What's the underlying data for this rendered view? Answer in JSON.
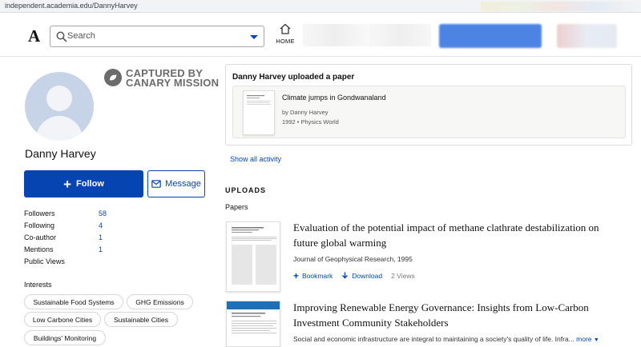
{
  "browser": {
    "url": "independent.academia.edu/DannyHarvey"
  },
  "header": {
    "logo": "A",
    "search_placeholder": "Search",
    "home_label": "HOME"
  },
  "profile": {
    "name": "Danny Harvey",
    "watermark": {
      "line1": "CAPTURED BY",
      "line2": "CANARY MISSION"
    },
    "follow_label": "Follow",
    "message_label": "Message",
    "stats": [
      {
        "label": "Followers",
        "value": "58"
      },
      {
        "label": "Following",
        "value": "4"
      },
      {
        "label": "Co-author",
        "value": "1"
      },
      {
        "label": "Mentions",
        "value": "1"
      },
      {
        "label": "Public Views",
        "value": ""
      }
    ],
    "interests_title": "Interests",
    "interests": [
      "Sustainable Food Systems",
      "GHG Emissions",
      "Low Carbone Cities",
      "Sustainable Cities",
      "Buildings' Monitoring"
    ]
  },
  "activity": {
    "title": "Danny Harvey uploaded a paper",
    "paper_title": "Climate jumps in Gondwanaland",
    "author": "by Danny Harvey",
    "meta": "1992 • Physics World",
    "show_all": "Show all activity"
  },
  "uploads": {
    "heading": "UPLOADS",
    "subheading": "Papers",
    "items": [
      {
        "title_line1": "Evaluation of the potential impact of methane clathrate destabilization on",
        "title_line2": "future global warming",
        "journal": "Journal of Geophysical Research, 1995",
        "bookmark": "Bookmark",
        "download": "Download",
        "views": "2 Views"
      },
      {
        "title_line1": "Improving Renewable Energy Governance: Insights from Low-Carbon",
        "title_line2": "Investment Community Stakeholders",
        "abstract": "Social and economic infrastructure are integral to maintaining a society's quality of life. Infra...",
        "more": "more"
      }
    ]
  },
  "colors": {
    "brand_blue": "#0645b1",
    "watermark_gray": "#6b6b6b"
  }
}
